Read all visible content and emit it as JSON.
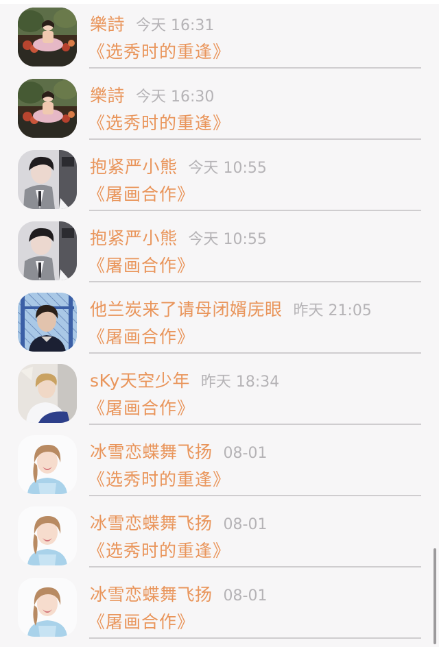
{
  "comments": [
    {
      "name": "樂詩",
      "time": "今天 16:31",
      "title": "《选秀时的重逢》",
      "avatar": "painting-avatar"
    },
    {
      "name": "樂詩",
      "time": "今天 16:30",
      "title": "《选秀时的重逢》",
      "avatar": "painting-avatar"
    },
    {
      "name": "抱紧严小熊",
      "time": "今天 10:55",
      "title": "《屠画合作》",
      "avatar": "suit-boy-avatar"
    },
    {
      "name": "抱紧严小熊",
      "time": "今天 10:55",
      "title": "《屠画合作》",
      "avatar": "suit-boy-avatar"
    },
    {
      "name": "他兰炭来了请母闭婿庑眼",
      "time": "昨天 21:05",
      "title": "《屠画合作》",
      "avatar": "outdoor-boy-avatar"
    },
    {
      "name": "sKy天空少年",
      "time": "昨天 18:34",
      "title": "《屠画合作》",
      "avatar": "jacket-boy-avatar"
    },
    {
      "name": "冰雪恋蝶舞飞扬",
      "time": "08-01",
      "title": "《选秀时的重逢》",
      "avatar": "smiling-girl-avatar"
    },
    {
      "name": "冰雪恋蝶舞飞扬",
      "time": "08-01",
      "title": "《选秀时的重逢》",
      "avatar": "smiling-girl-avatar"
    },
    {
      "name": "冰雪恋蝶舞飞扬",
      "time": "08-01",
      "title": "《屠画合作》",
      "avatar": "smiling-girl-avatar"
    }
  ],
  "colors": {
    "name": "#e9955b",
    "time": "#b5b3b6",
    "background": "#f7f6f7",
    "divider": "#cfcdcf"
  }
}
